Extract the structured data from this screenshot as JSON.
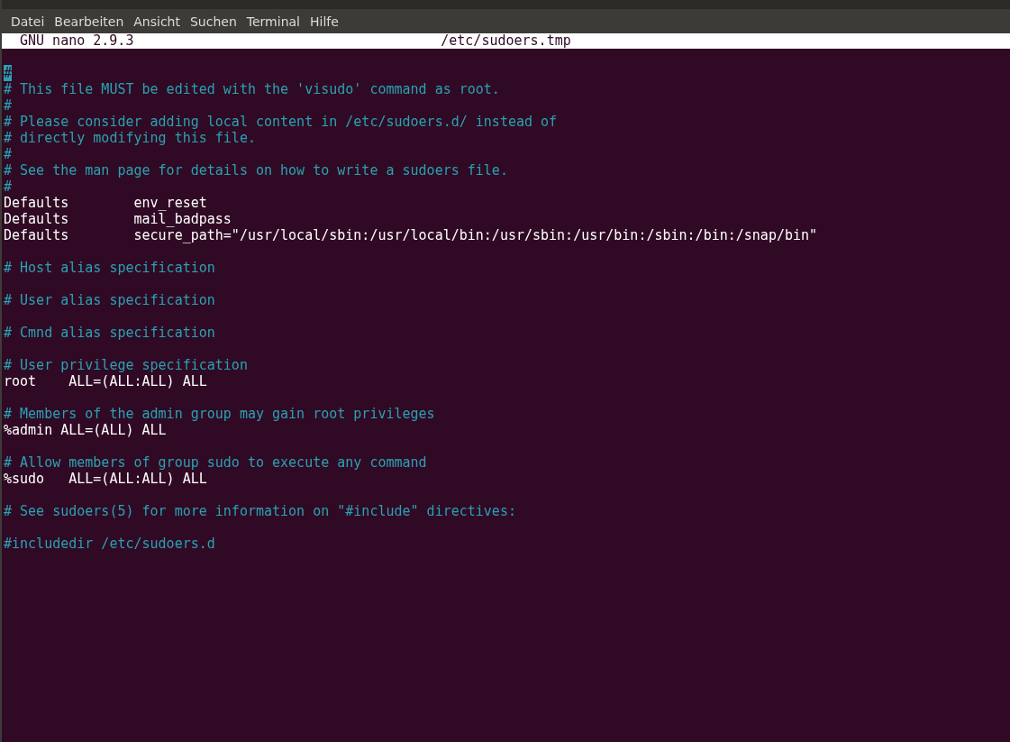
{
  "menu_bar": [
    {
      "label": "Datei"
    },
    {
      "label": "Bearbeiten"
    },
    {
      "label": "Ansicht"
    },
    {
      "label": "Suchen"
    },
    {
      "label": "Terminal"
    },
    {
      "label": "Hilfe"
    }
  ],
  "header": {
    "app": "GNU nano 2.9.3",
    "file": "/etc/sudoers.tmp"
  },
  "lines": [
    {
      "kind": "blank"
    },
    {
      "kind": "comment",
      "text": "#",
      "cursor": true
    },
    {
      "kind": "comment",
      "text": "# This file MUST be edited with the 'visudo' command as root.",
      "cursor": false
    },
    {
      "kind": "comment",
      "text": "#",
      "cursor": false
    },
    {
      "kind": "comment",
      "text": "# Please consider adding local content in /etc/sudoers.d/ instead of",
      "cursor": false
    },
    {
      "kind": "comment",
      "text": "# directly modifying this file.",
      "cursor": false
    },
    {
      "kind": "comment",
      "text": "#",
      "cursor": false
    },
    {
      "kind": "comment",
      "text": "# See the man page for details on how to write a sudoers file.",
      "cursor": false
    },
    {
      "kind": "comment",
      "text": "#",
      "cursor": false
    },
    {
      "kind": "code",
      "text": "Defaults        env_reset",
      "cursor": false
    },
    {
      "kind": "code",
      "text": "Defaults        mail_badpass",
      "cursor": false
    },
    {
      "kind": "code",
      "text": "Defaults        secure_path=\"/usr/local/sbin:/usr/local/bin:/usr/sbin:/usr/bin:/sbin:/bin:/snap/bin\"",
      "cursor": false
    },
    {
      "kind": "blank"
    },
    {
      "kind": "comment",
      "text": "# Host alias specification",
      "cursor": false
    },
    {
      "kind": "blank"
    },
    {
      "kind": "comment",
      "text": "# User alias specification",
      "cursor": false
    },
    {
      "kind": "blank"
    },
    {
      "kind": "comment",
      "text": "# Cmnd alias specification",
      "cursor": false
    },
    {
      "kind": "blank"
    },
    {
      "kind": "comment",
      "text": "# User privilege specification",
      "cursor": false
    },
    {
      "kind": "code",
      "text": "root    ALL=(ALL:ALL) ALL",
      "cursor": false
    },
    {
      "kind": "blank"
    },
    {
      "kind": "comment",
      "text": "# Members of the admin group may gain root privileges",
      "cursor": false
    },
    {
      "kind": "code",
      "text": "%admin ALL=(ALL) ALL",
      "cursor": false
    },
    {
      "kind": "blank"
    },
    {
      "kind": "comment",
      "text": "# Allow members of group sudo to execute any command",
      "cursor": false
    },
    {
      "kind": "code",
      "text": "%sudo   ALL=(ALL:ALL) ALL",
      "cursor": false
    },
    {
      "kind": "blank"
    },
    {
      "kind": "comment",
      "text": "# See sudoers(5) for more information on \"#include\" directives:",
      "cursor": false
    },
    {
      "kind": "blank"
    },
    {
      "kind": "comment",
      "text": "#includedir /etc/sudoers.d",
      "cursor": false
    }
  ]
}
